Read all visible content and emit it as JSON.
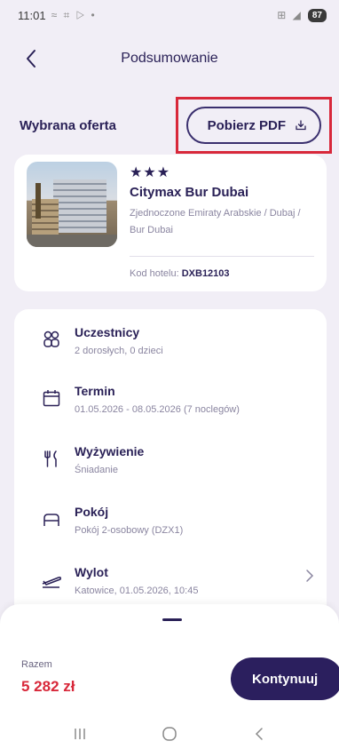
{
  "status_bar": {
    "time": "11:01",
    "icons": "≈ ⌗ ▷ •",
    "signal": "⊞ ◢",
    "battery": "87"
  },
  "header": {
    "title": "Podsumowanie",
    "back_icon": "chevron-left-icon"
  },
  "offer": {
    "label": "Wybrana oferta",
    "pdf_button": "Pobierz PDF",
    "pdf_icon": "download-icon",
    "highlight_color": "#d8283a"
  },
  "hotel": {
    "stars": "★★★",
    "name": "Citymax Bur Dubai",
    "location": "Zjednoczone Emiraty Arabskie / Dubaj / Bur Dubai",
    "code_label": "Kod hotelu:",
    "code": "DXB12103"
  },
  "details": [
    {
      "icon": "participants-icon",
      "title": "Uczestnicy",
      "sub": "2 dorosłych, 0 dzieci"
    },
    {
      "icon": "calendar-icon",
      "title": "Termin",
      "sub": "01.05.2026 - 08.05.2026 (7 noclegów)"
    },
    {
      "icon": "cutlery-icon",
      "title": "Wyżywienie",
      "sub": "Śniadanie"
    },
    {
      "icon": "bed-icon",
      "title": "Pokój",
      "sub": "Pokój 2-osobowy (DZX1)"
    },
    {
      "icon": "plane-icon",
      "title": "Wylot",
      "sub": "Katowice, 01.05.2026, 10:45"
    }
  ],
  "summary": {
    "total_label": "Razem",
    "total_value": "5 282 zł",
    "continue_button": "Kontynuuj"
  },
  "colors": {
    "primary": "#2b1f5e",
    "price": "#d8283a",
    "background": "#f1eef6"
  }
}
